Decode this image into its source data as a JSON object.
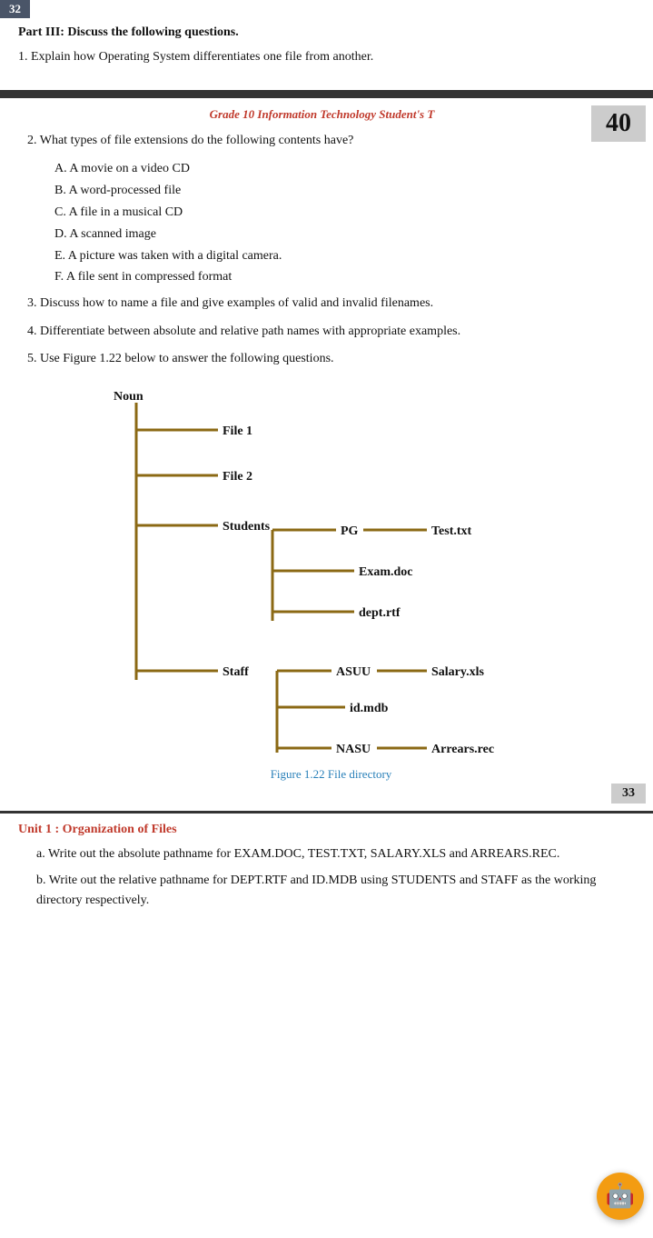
{
  "page32": {
    "page_number": "32",
    "part_heading": "Part III: Discuss the following questions.",
    "question1": "1.  Explain how Operating System differentiates one file from another."
  },
  "page33": {
    "page_number": "33",
    "page_num_badge": "40",
    "grade_title": "Grade 10 Information Technology Student's T",
    "question2_label": "2.  What types of file extensions do the following contents have?",
    "sub_items": [
      "A. A movie on a video CD",
      "B. A word-processed file",
      "C. A file in a musical CD",
      "D. A scanned image",
      "E.  A picture was taken with a digital camera.",
      "F.  A file sent in compressed format"
    ],
    "question3": "3.  Discuss how to name a file and give examples of valid and invalid filenames.",
    "question4": "4.   Differentiate between absolute and relative path names with appropriate examples.",
    "question5": "5.  Use Figure 1.22 below to answer the following questions.",
    "tree": {
      "root": "Noun",
      "nodes": [
        "File 1",
        "File 2",
        "Students",
        "PG",
        "Test.txt",
        "Exam.doc",
        "dept.rtf",
        "Staff",
        "ASUU",
        "Salary.xls",
        "id.mdb",
        "NASU",
        "Arrears.rec"
      ]
    },
    "fig_caption": "Figure 1.22 File directory"
  },
  "unit_section": {
    "title": "Unit 1 : Organization of Files",
    "items": [
      {
        "prefix": "a.",
        "text": "Write out the absolute pathname for EXAM.DOC, TEST.TXT, SALARY.XLS and ARREARS.REC."
      },
      {
        "prefix": "b.",
        "text": "Write out the relative pathname for DEPT.RTF and ID.MDB using STUDENTS and STAFF as the working directory respectively."
      }
    ]
  }
}
